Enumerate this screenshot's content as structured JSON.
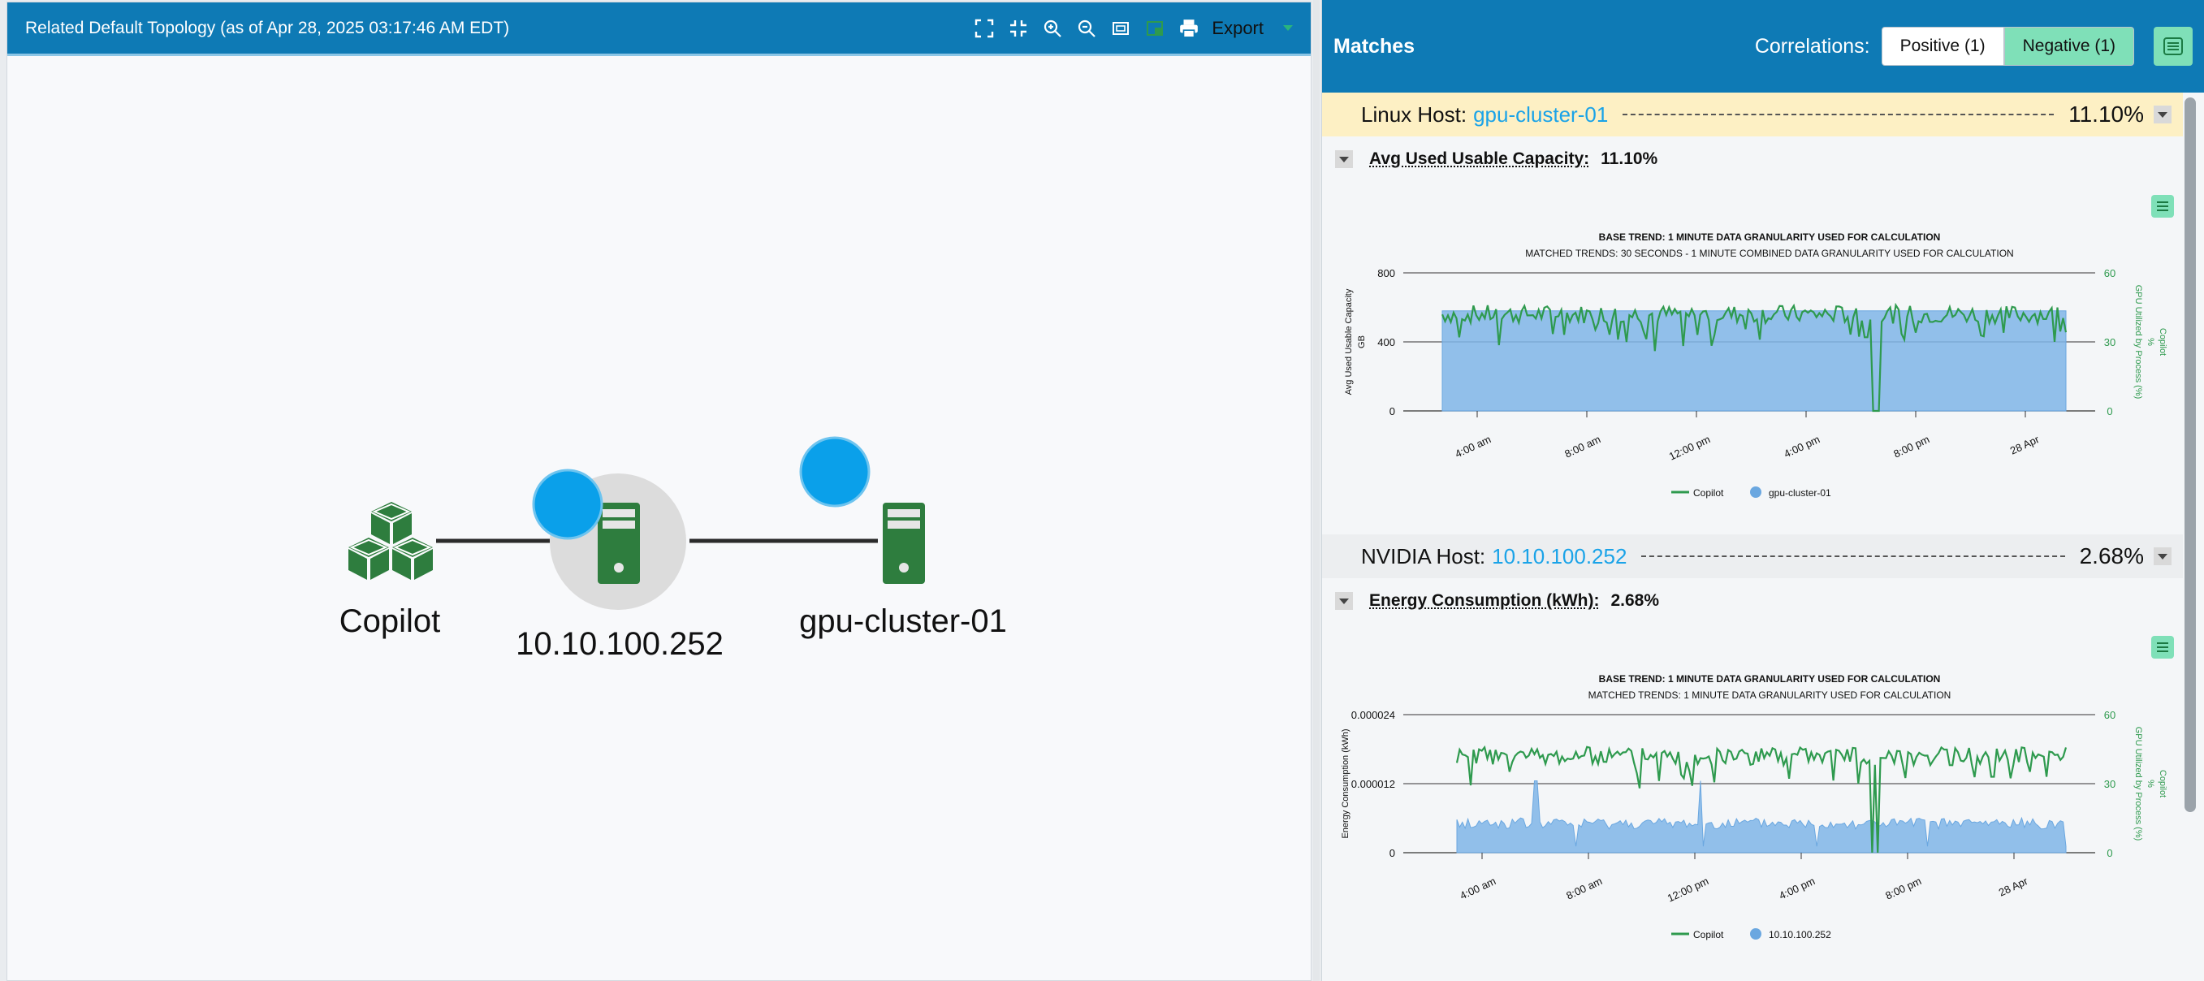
{
  "topology": {
    "title": "Related Default Topology (as of Apr 28, 2025 03:17:46 AM EDT)",
    "toolbar": {
      "icons": [
        "fullscreen-icon",
        "shrink-icon",
        "zoom-in-icon",
        "zoom-out-icon",
        "fit-icon",
        "minimap-icon",
        "print-icon"
      ],
      "export_label": "Export"
    },
    "nodes": [
      {
        "label": "Copilot",
        "kind": "process"
      },
      {
        "label": "10.10.100.252",
        "kind": "nvidia-host",
        "selected": true
      },
      {
        "label": "gpu-cluster-01",
        "kind": "linux-host"
      }
    ]
  },
  "matches": {
    "title": "Matches",
    "correlations_label": "Correlations:",
    "positive_label": "Positive (1)",
    "negative_label": "Negative (1)",
    "hosts": [
      {
        "type_label": "Linux Host:",
        "name": "gpu-cluster-01",
        "percent": "11.10%",
        "metric_name": "Avg Used Usable Capacity:",
        "metric_value": "11.10%"
      },
      {
        "type_label": "NVIDIA Host:",
        "name": "10.10.100.252",
        "percent": "2.68%",
        "metric_name": "Energy Consumption (kWh):",
        "metric_value": "2.68%"
      }
    ]
  },
  "colors": {
    "header_blue": "#0e7ab5",
    "accent_green": "#2e9a4e",
    "area_blue": "#7fb5e8",
    "node_green": "#2e7d3e",
    "badge_blue": "#0aa0ea",
    "highlight_row": "#fdf0c4"
  },
  "chart_data": [
    {
      "type": "area",
      "title": "BASE TREND: 1 MINUTE DATA GRANULARITY USED FOR CALCULATION",
      "subtitle": "MATCHED TRENDS: 30 SECONDS - 1 MINUTE COMBINED DATA GRANULARITY USED FOR CALCULATION",
      "ylabel": "Avg Used Usable Capacity",
      "ylabel_unit": "GB",
      "y2label": "Copilot",
      "y2label_sub": "GPU Utilized by Process (%)",
      "y2label_unit": "%",
      "yticks": [
        "800",
        "400",
        "0"
      ],
      "ylim": [
        0,
        800
      ],
      "y2ticks": [
        "60",
        "30",
        "0"
      ],
      "y2lim": [
        0,
        60
      ],
      "xticks": [
        "4:00 am",
        "8:00 am",
        "12:00 pm",
        "4:00 pm",
        "8:00 pm",
        "28 Apr"
      ],
      "series": [
        {
          "name": "gpu-cluster-01",
          "axis": "left",
          "style": "area",
          "base": 580,
          "dips": []
        },
        {
          "name": "Copilot",
          "axis": "right",
          "style": "line",
          "base": 42,
          "noise": 4,
          "dips": [
            [
              0.34,
              26
            ],
            [
              0.51,
              31
            ],
            [
              0.68,
              32
            ],
            [
              0.693,
              0
            ],
            [
              0.7,
              0
            ],
            [
              0.9,
              34
            ]
          ]
        }
      ],
      "legend": [
        "Copilot",
        "gpu-cluster-01"
      ]
    },
    {
      "type": "area",
      "title": "BASE TREND: 1 MINUTE DATA GRANULARITY USED FOR CALCULATION",
      "subtitle": "MATCHED TRENDS: 1 MINUTE DATA GRANULARITY USED FOR CALCULATION",
      "ylabel": "Energy Consumption (kWh)",
      "ylabel_unit": "",
      "y2label": "Copilot",
      "y2label_sub": "GPU Utilized by Process (%)",
      "y2label_unit": "%",
      "yticks": [
        "0.000024",
        "0.000012",
        "0"
      ],
      "ylim": [
        0,
        2.4e-05
      ],
      "y2ticks": [
        "60",
        "30",
        "0"
      ],
      "y2lim": [
        0,
        60
      ],
      "xticks": [
        "4:00 am",
        "8:00 am",
        "12:00 pm",
        "4:00 pm",
        "8:00 pm",
        "28 Apr"
      ],
      "series": [
        {
          "name": "10.10.100.252",
          "axis": "left",
          "style": "area",
          "base": 5.5e-06,
          "spikes": [
            [
              0.13,
              1.25e-05
            ],
            [
              0.4,
              1.25e-05
            ]
          ]
        },
        {
          "name": "Copilot",
          "axis": "right",
          "style": "line",
          "base": 42,
          "noise": 4,
          "dips": [
            [
              0.3,
              28
            ],
            [
              0.66,
              30
            ],
            [
              0.683,
              0
            ],
            [
              0.69,
              0
            ],
            [
              0.88,
              33
            ]
          ]
        }
      ],
      "legend": [
        "Copilot",
        "10.10.100.252"
      ]
    }
  ]
}
